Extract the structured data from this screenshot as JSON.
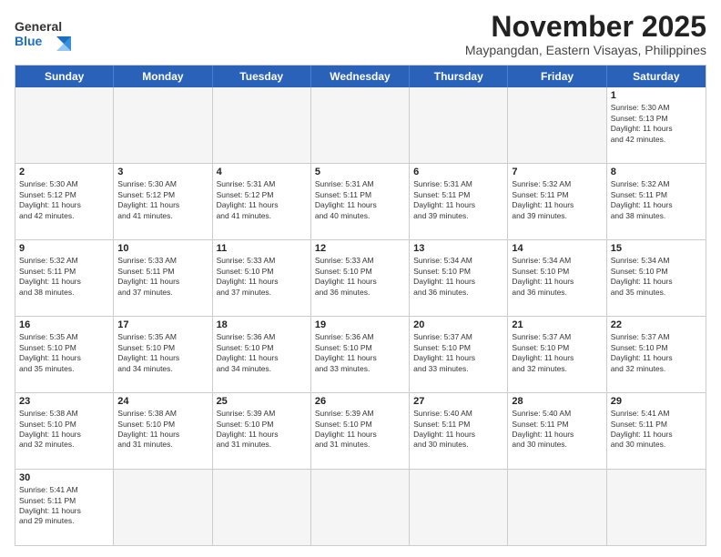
{
  "header": {
    "logo_general": "General",
    "logo_blue": "Blue",
    "month_title": "November 2025",
    "location": "Maypangdan, Eastern Visayas, Philippines"
  },
  "days_of_week": [
    "Sunday",
    "Monday",
    "Tuesday",
    "Wednesday",
    "Thursday",
    "Friday",
    "Saturday"
  ],
  "weeks": [
    [
      {
        "day": "",
        "info": ""
      },
      {
        "day": "",
        "info": ""
      },
      {
        "day": "",
        "info": ""
      },
      {
        "day": "",
        "info": ""
      },
      {
        "day": "",
        "info": ""
      },
      {
        "day": "",
        "info": ""
      },
      {
        "day": "1",
        "info": "Sunrise: 5:30 AM\nSunset: 5:13 PM\nDaylight: 11 hours\nand 42 minutes."
      }
    ],
    [
      {
        "day": "2",
        "info": "Sunrise: 5:30 AM\nSunset: 5:12 PM\nDaylight: 11 hours\nand 42 minutes."
      },
      {
        "day": "3",
        "info": "Sunrise: 5:30 AM\nSunset: 5:12 PM\nDaylight: 11 hours\nand 41 minutes."
      },
      {
        "day": "4",
        "info": "Sunrise: 5:31 AM\nSunset: 5:12 PM\nDaylight: 11 hours\nand 41 minutes."
      },
      {
        "day": "5",
        "info": "Sunrise: 5:31 AM\nSunset: 5:11 PM\nDaylight: 11 hours\nand 40 minutes."
      },
      {
        "day": "6",
        "info": "Sunrise: 5:31 AM\nSunset: 5:11 PM\nDaylight: 11 hours\nand 39 minutes."
      },
      {
        "day": "7",
        "info": "Sunrise: 5:32 AM\nSunset: 5:11 PM\nDaylight: 11 hours\nand 39 minutes."
      },
      {
        "day": "8",
        "info": "Sunrise: 5:32 AM\nSunset: 5:11 PM\nDaylight: 11 hours\nand 38 minutes."
      }
    ],
    [
      {
        "day": "9",
        "info": "Sunrise: 5:32 AM\nSunset: 5:11 PM\nDaylight: 11 hours\nand 38 minutes."
      },
      {
        "day": "10",
        "info": "Sunrise: 5:33 AM\nSunset: 5:11 PM\nDaylight: 11 hours\nand 37 minutes."
      },
      {
        "day": "11",
        "info": "Sunrise: 5:33 AM\nSunset: 5:10 PM\nDaylight: 11 hours\nand 37 minutes."
      },
      {
        "day": "12",
        "info": "Sunrise: 5:33 AM\nSunset: 5:10 PM\nDaylight: 11 hours\nand 36 minutes."
      },
      {
        "day": "13",
        "info": "Sunrise: 5:34 AM\nSunset: 5:10 PM\nDaylight: 11 hours\nand 36 minutes."
      },
      {
        "day": "14",
        "info": "Sunrise: 5:34 AM\nSunset: 5:10 PM\nDaylight: 11 hours\nand 36 minutes."
      },
      {
        "day": "15",
        "info": "Sunrise: 5:34 AM\nSunset: 5:10 PM\nDaylight: 11 hours\nand 35 minutes."
      }
    ],
    [
      {
        "day": "16",
        "info": "Sunrise: 5:35 AM\nSunset: 5:10 PM\nDaylight: 11 hours\nand 35 minutes."
      },
      {
        "day": "17",
        "info": "Sunrise: 5:35 AM\nSunset: 5:10 PM\nDaylight: 11 hours\nand 34 minutes."
      },
      {
        "day": "18",
        "info": "Sunrise: 5:36 AM\nSunset: 5:10 PM\nDaylight: 11 hours\nand 34 minutes."
      },
      {
        "day": "19",
        "info": "Sunrise: 5:36 AM\nSunset: 5:10 PM\nDaylight: 11 hours\nand 33 minutes."
      },
      {
        "day": "20",
        "info": "Sunrise: 5:37 AM\nSunset: 5:10 PM\nDaylight: 11 hours\nand 33 minutes."
      },
      {
        "day": "21",
        "info": "Sunrise: 5:37 AM\nSunset: 5:10 PM\nDaylight: 11 hours\nand 32 minutes."
      },
      {
        "day": "22",
        "info": "Sunrise: 5:37 AM\nSunset: 5:10 PM\nDaylight: 11 hours\nand 32 minutes."
      }
    ],
    [
      {
        "day": "23",
        "info": "Sunrise: 5:38 AM\nSunset: 5:10 PM\nDaylight: 11 hours\nand 32 minutes."
      },
      {
        "day": "24",
        "info": "Sunrise: 5:38 AM\nSunset: 5:10 PM\nDaylight: 11 hours\nand 31 minutes."
      },
      {
        "day": "25",
        "info": "Sunrise: 5:39 AM\nSunset: 5:10 PM\nDaylight: 11 hours\nand 31 minutes."
      },
      {
        "day": "26",
        "info": "Sunrise: 5:39 AM\nSunset: 5:10 PM\nDaylight: 11 hours\nand 31 minutes."
      },
      {
        "day": "27",
        "info": "Sunrise: 5:40 AM\nSunset: 5:11 PM\nDaylight: 11 hours\nand 30 minutes."
      },
      {
        "day": "28",
        "info": "Sunrise: 5:40 AM\nSunset: 5:11 PM\nDaylight: 11 hours\nand 30 minutes."
      },
      {
        "day": "29",
        "info": "Sunrise: 5:41 AM\nSunset: 5:11 PM\nDaylight: 11 hours\nand 30 minutes."
      }
    ],
    [
      {
        "day": "30",
        "info": "Sunrise: 5:41 AM\nSunset: 5:11 PM\nDaylight: 11 hours\nand 29 minutes."
      },
      {
        "day": "",
        "info": ""
      },
      {
        "day": "",
        "info": ""
      },
      {
        "day": "",
        "info": ""
      },
      {
        "day": "",
        "info": ""
      },
      {
        "day": "",
        "info": ""
      },
      {
        "day": "",
        "info": ""
      }
    ]
  ]
}
